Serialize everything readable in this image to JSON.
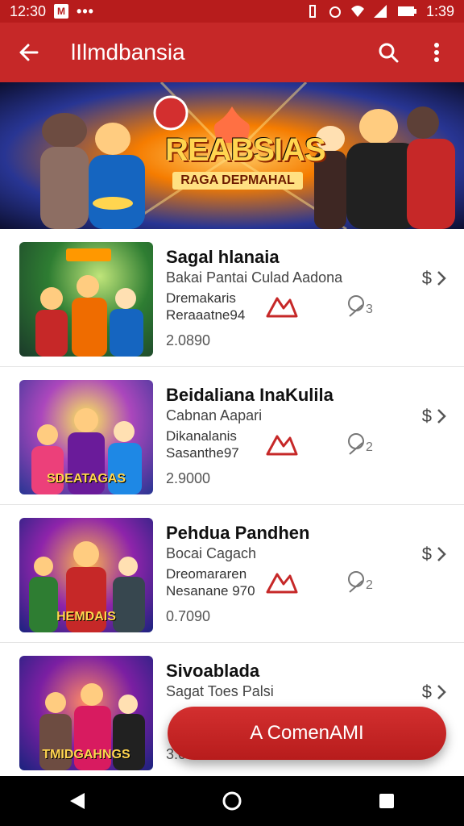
{
  "status_bar": {
    "time_left": "12:30",
    "time_right": "1:39",
    "notification_box": "M",
    "dots": "•••"
  },
  "app_bar": {
    "title": "lIlmdbansia"
  },
  "banner": {
    "title": "REABSIAS",
    "subtitle": "RAGA DEPMAHAL"
  },
  "items": [
    {
      "title": "Sagal hlanaia",
      "subtitle": "Bakai Pantai Culad Aadona",
      "meta1": "Dremakaris",
      "meta2": "Reraaatne94",
      "price": "2.0890",
      "thumb_caption": "",
      "brand_icon": "red-brand-icon",
      "gift_icon": "gift-icon",
      "price_symbol": "$"
    },
    {
      "title": "Beidaliana InaKulila",
      "subtitle": "Cabnan Aapari",
      "meta1": "Dikanalanis",
      "meta2": "Sasanthe97",
      "price": "2.9000",
      "thumb_caption": "SDEATAGAS",
      "brand_icon": "red-brand-icon",
      "gift_icon": "gift-icon",
      "price_symbol": "$"
    },
    {
      "title": "Pehdua Pandhen",
      "subtitle": "Bocai Cagach",
      "meta1": "Dreomararen",
      "meta2": "Nesanane 970",
      "price": "0.7090",
      "thumb_caption": "HEMDAIS",
      "brand_icon": "red-brand-icon",
      "gift_icon": "gift-icon",
      "price_symbol": "$"
    },
    {
      "title": "Sivoablada",
      "subtitle": "Sagat Toes Palsi",
      "meta1": "",
      "meta2": "",
      "price": "3.0690",
      "thumb_caption": "TMIDGAHNGS",
      "brand_icon": "",
      "gift_icon": "",
      "price_symbol": "$"
    }
  ],
  "fab": {
    "label": "A ComenAMI"
  },
  "colors": {
    "primary": "#c62828",
    "primary_dark": "#b71c1c",
    "accent_gold": "#ffd54f"
  }
}
